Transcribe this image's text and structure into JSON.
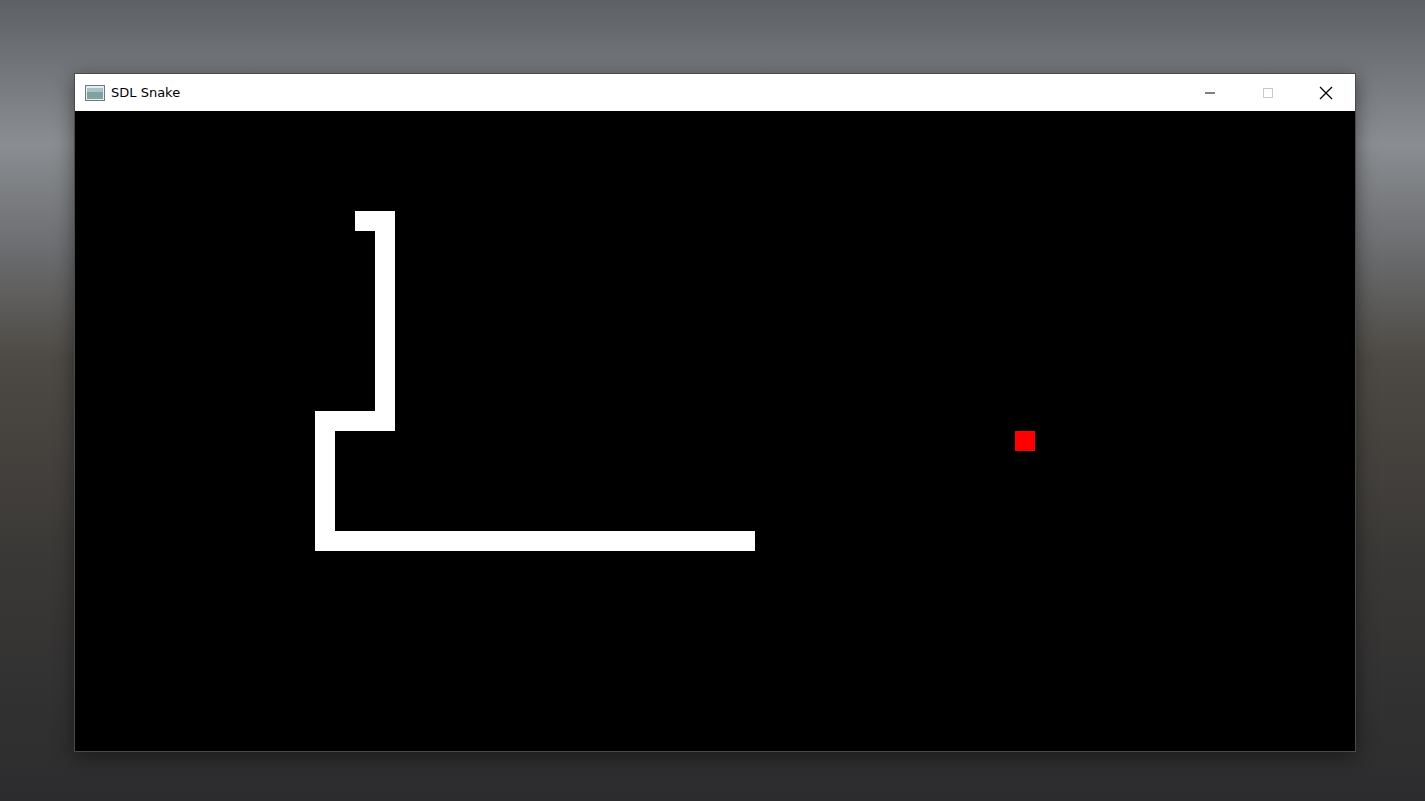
{
  "window": {
    "title": "SDL Snake",
    "controls": [
      {
        "kind": "minimize",
        "disabled": false
      },
      {
        "kind": "maximize",
        "disabled": true
      },
      {
        "kind": "close",
        "disabled": false
      }
    ]
  },
  "game": {
    "columns": 64,
    "rows": 32,
    "snake": [
      [
        14,
        5
      ],
      [
        15,
        5
      ],
      [
        15,
        6
      ],
      [
        15,
        7
      ],
      [
        15,
        8
      ],
      [
        15,
        9
      ],
      [
        15,
        10
      ],
      [
        15,
        11
      ],
      [
        15,
        12
      ],
      [
        15,
        13
      ],
      [
        15,
        14
      ],
      [
        15,
        15
      ],
      [
        14,
        15
      ],
      [
        13,
        15
      ],
      [
        12,
        15
      ],
      [
        12,
        16
      ],
      [
        12,
        17
      ],
      [
        12,
        18
      ],
      [
        12,
        19
      ],
      [
        12,
        20
      ],
      [
        12,
        21
      ],
      [
        13,
        21
      ],
      [
        14,
        21
      ],
      [
        15,
        21
      ],
      [
        16,
        21
      ],
      [
        17,
        21
      ],
      [
        18,
        21
      ],
      [
        19,
        21
      ],
      [
        20,
        21
      ],
      [
        21,
        21
      ],
      [
        22,
        21
      ],
      [
        23,
        21
      ],
      [
        24,
        21
      ],
      [
        25,
        21
      ],
      [
        26,
        21
      ],
      [
        27,
        21
      ],
      [
        28,
        21
      ],
      [
        29,
        21
      ],
      [
        30,
        21
      ],
      [
        31,
        21
      ],
      [
        32,
        21
      ],
      [
        33,
        21
      ]
    ],
    "food": [
      47,
      16
    ]
  }
}
